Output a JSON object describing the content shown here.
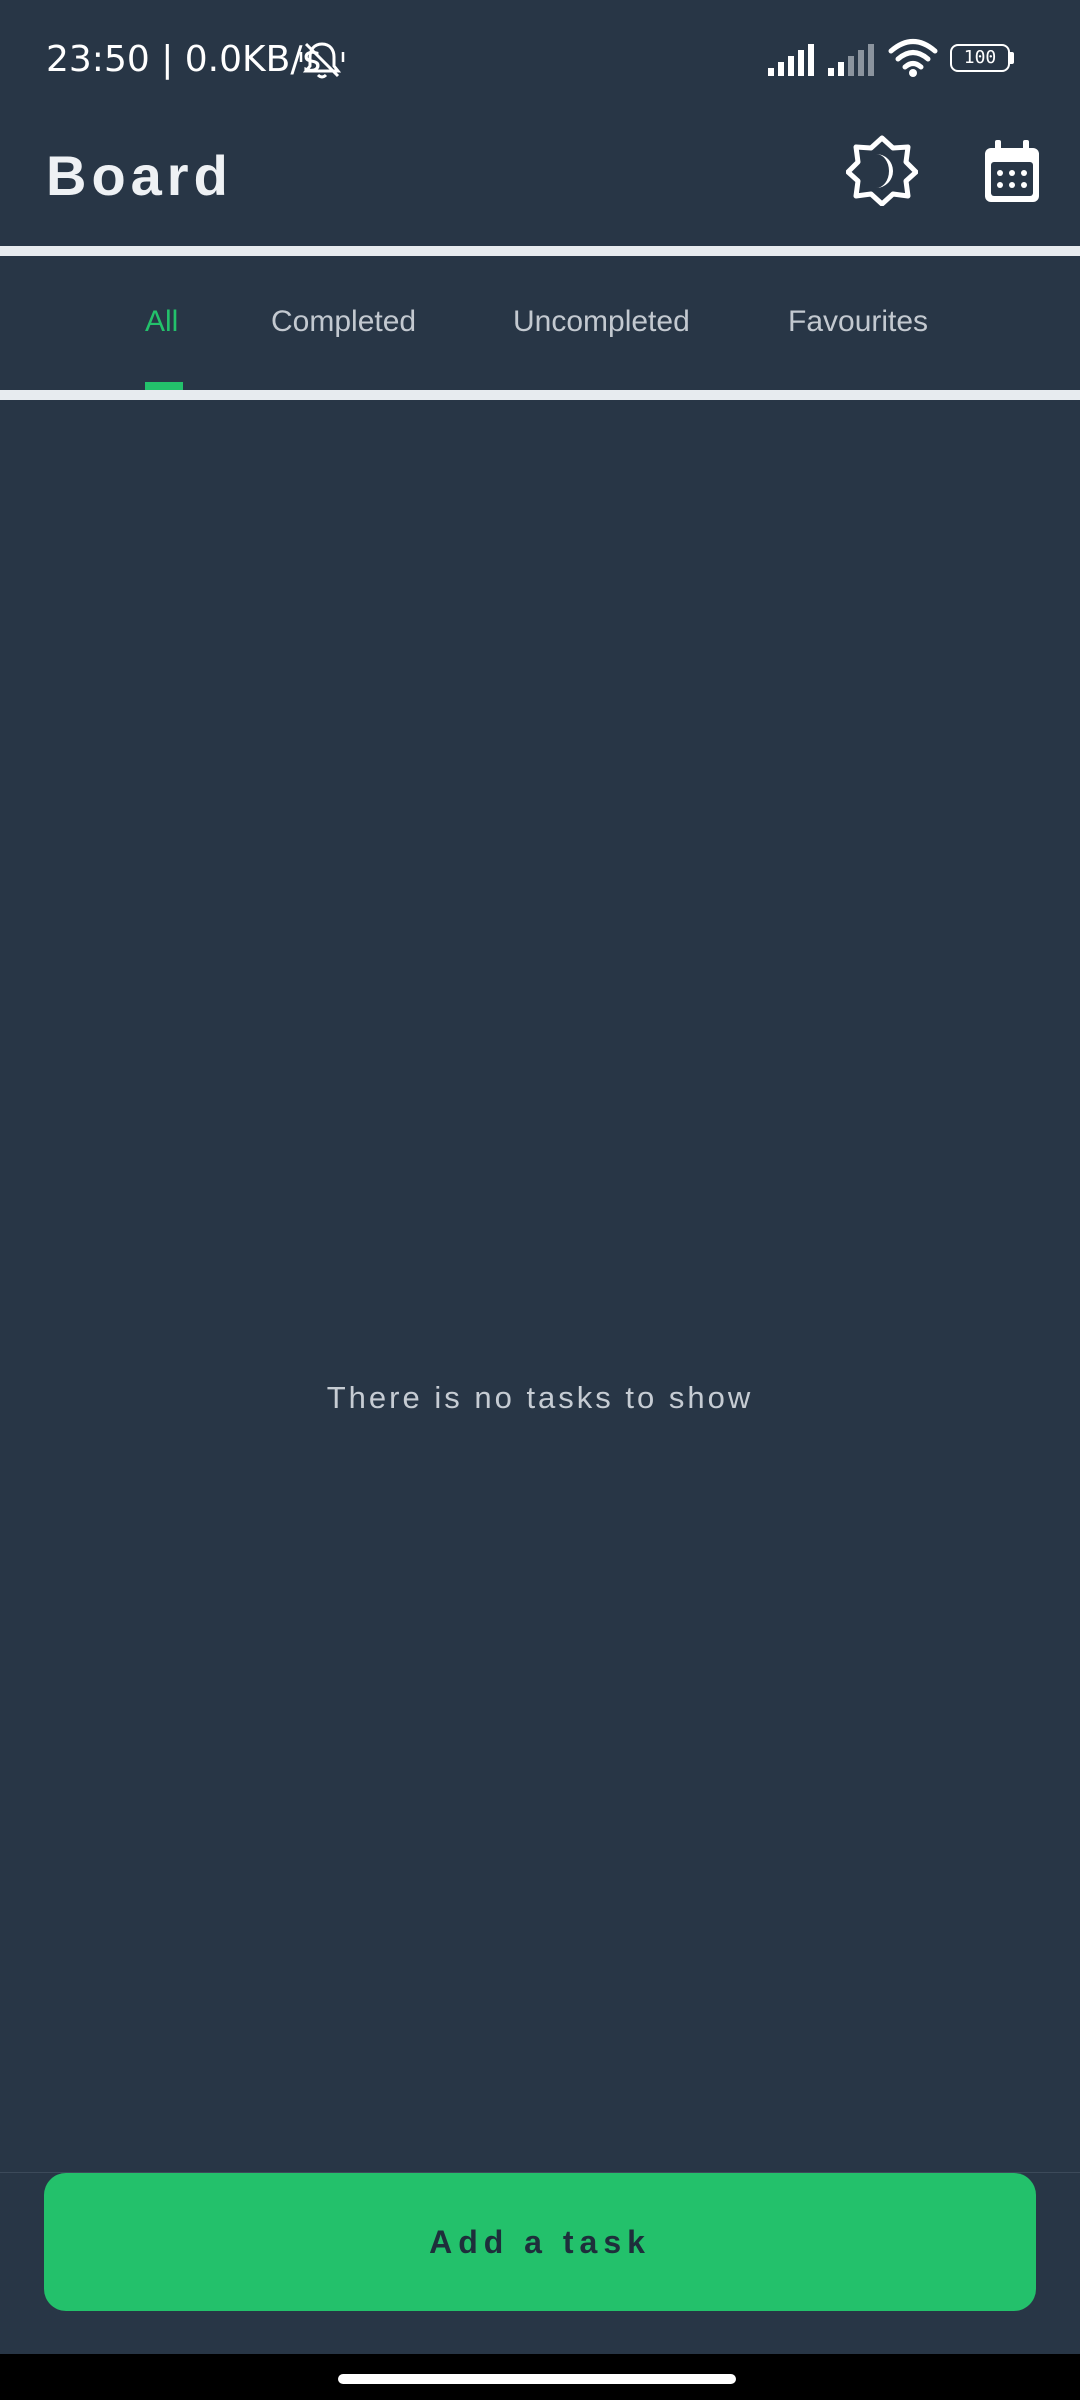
{
  "status_bar": {
    "time_speed": "23:50 | 0.0KB/s",
    "battery": "100",
    "icons": [
      "mute-bell-icon",
      "signal-icon",
      "signal-icon",
      "wifi-icon",
      "battery-icon"
    ]
  },
  "app_bar": {
    "title": "Board",
    "actions": [
      "theme-toggle-icon",
      "calendar-icon"
    ]
  },
  "tabs": [
    {
      "label": "All",
      "active": true
    },
    {
      "label": "Completed",
      "active": false
    },
    {
      "label": "Uncompleted",
      "active": false
    },
    {
      "label": "Favourites",
      "active": false
    }
  ],
  "main": {
    "empty_message": "There is no tasks to show"
  },
  "footer": {
    "add_button_label": "Add a task"
  },
  "colors": {
    "background": "#283646",
    "accent": "#23c16b",
    "divider": "#e7ebef",
    "tab_inactive": "#c3c9d0"
  }
}
